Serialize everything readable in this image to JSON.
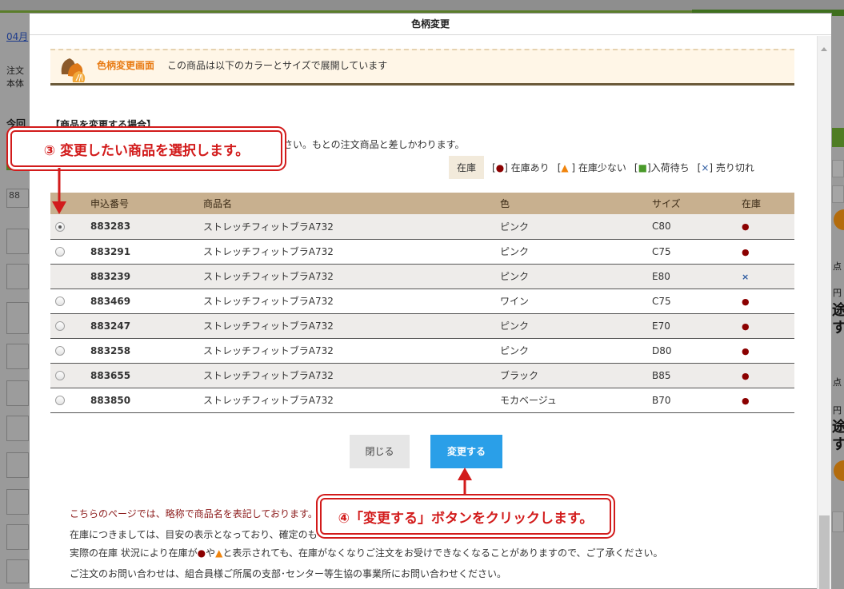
{
  "background": {
    "link_text": "04月",
    "text_line1": "注文",
    "text_line2": "本体",
    "label_today": "今回",
    "field_value": "88",
    "right_labels": [
      "点",
      "円",
      "途",
      "す",
      "点",
      "円",
      "途",
      "す"
    ]
  },
  "modal": {
    "title": "色柄変更",
    "banner": {
      "title": "色柄変更画面",
      "text": "この商品は以下のカラーとサイズで展開しています"
    },
    "section_title": "【商品を変更する場合】",
    "instruction": "ださい。もとの注文商品と差しかわります。",
    "legend": {
      "label": "在庫",
      "items": [
        {
          "prefix": "[",
          "mark": "●",
          "suffix": "] 在庫あり"
        },
        {
          "prefix": "[",
          "mark": "▲",
          "suffix": " ] 在庫少ない"
        },
        {
          "prefix": "[",
          "mark": "■",
          "suffix": "]入荷待ち"
        },
        {
          "prefix": "[",
          "mark": "×",
          "suffix": "] 売り切れ"
        }
      ]
    },
    "table": {
      "headers": [
        "",
        "申込番号",
        "商品名",
        "色",
        "サイズ",
        "在庫"
      ],
      "rows": [
        {
          "no": "883283",
          "name": "ストレッチフィットブラA732",
          "color": "ピンク",
          "size": "C80",
          "stock": "●",
          "radio": "checked"
        },
        {
          "no": "883291",
          "name": "ストレッチフィットブラA732",
          "color": "ピンク",
          "size": "C75",
          "stock": "●",
          "radio": "unchecked"
        },
        {
          "no": "883239",
          "name": "ストレッチフィットブラA732",
          "color": "ピンク",
          "size": "E80",
          "stock": "×",
          "radio": "none"
        },
        {
          "no": "883469",
          "name": "ストレッチフィットブラA732",
          "color": "ワイン",
          "size": "C75",
          "stock": "●",
          "radio": "unchecked"
        },
        {
          "no": "883247",
          "name": "ストレッチフィットブラA732",
          "color": "ピンク",
          "size": "E70",
          "stock": "●",
          "radio": "unchecked"
        },
        {
          "no": "883258",
          "name": "ストレッチフィットブラA732",
          "color": "ピンク",
          "size": "D80",
          "stock": "●",
          "radio": "unchecked"
        },
        {
          "no": "883655",
          "name": "ストレッチフィットブラA732",
          "color": "ブラック",
          "size": "B85",
          "stock": "●",
          "radio": "unchecked"
        },
        {
          "no": "883850",
          "name": "ストレッチフィットブラA732",
          "color": "モカベージュ",
          "size": "B70",
          "stock": "●",
          "radio": "unchecked"
        }
      ]
    },
    "buttons": {
      "close": "閉じる",
      "change": "変更する"
    },
    "notes": {
      "red_note": "こちらのページでは、略称で商品名を表記しております。",
      "line1": "在庫につきましては、目安の表示となっており、確定のも",
      "line2_a": "実際の在庫 状況により在庫が",
      "line2_dot": "●",
      "line2_b": "や",
      "line2_tri": "▲",
      "line2_c": "と表示されても、在庫がなくなりご注文をお受けできなくなることがありますので、ご了承ください。",
      "line3": "ご注文のお問い合わせは、組合員様ご所属の支部･センター等生協の事業所にお問い合わせください。"
    }
  },
  "callouts": {
    "step3": "③ 変更したい商品を選択します。",
    "step4": "④「変更する」ボタンをクリックします。"
  },
  "colors": {
    "accent_red": "#d21b1b",
    "header_tan": "#c8b08f",
    "button_blue": "#2a9fe8",
    "banner_orange": "#e87b14"
  }
}
